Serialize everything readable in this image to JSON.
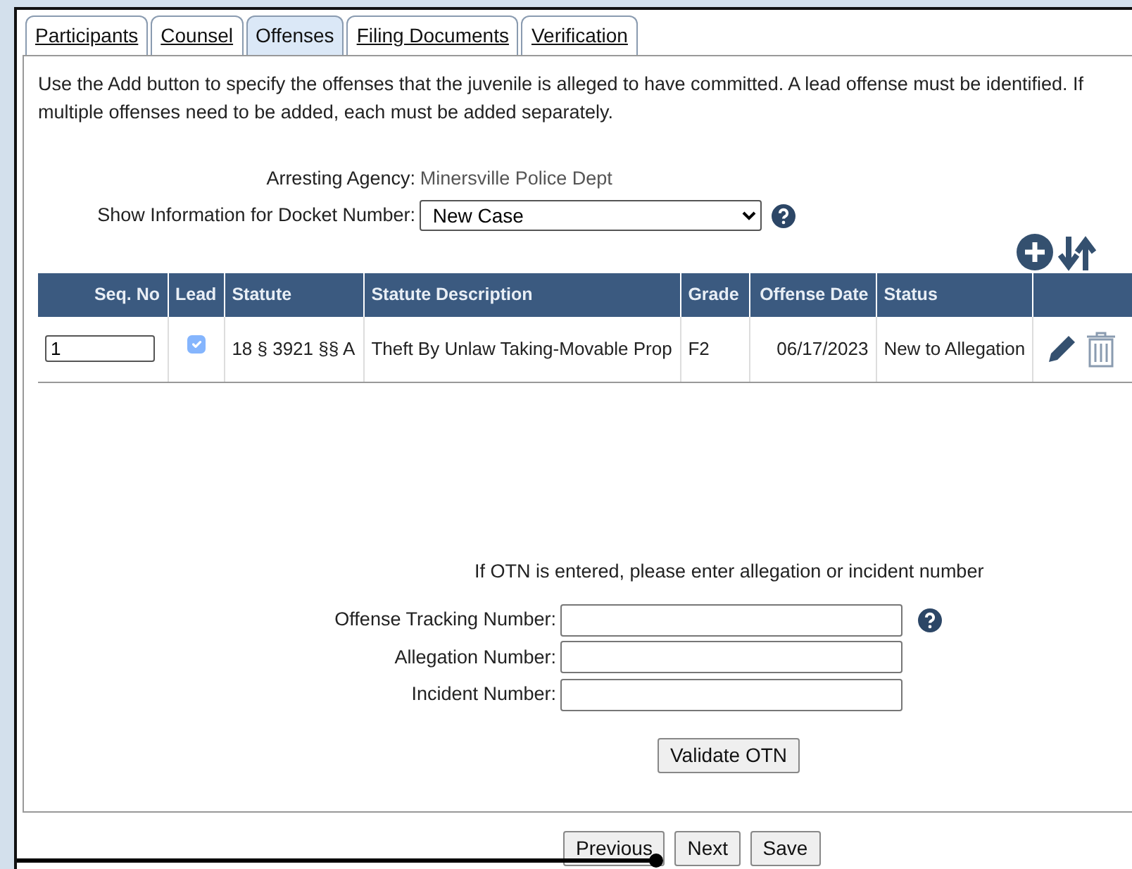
{
  "tabs": [
    {
      "label": "Participants",
      "selected": false
    },
    {
      "label": "Counsel",
      "selected": false
    },
    {
      "label": "Offenses",
      "selected": true
    },
    {
      "label": "Filing Documents",
      "selected": false
    },
    {
      "label": "Verification",
      "selected": false
    }
  ],
  "instructions": "Use the Add button to specify the offenses that the juvenile is alleged to have committed. A lead offense must be identified. If multiple offenses need to be added, each must be added separately.",
  "arresting_agency": {
    "label": "Arresting Agency:",
    "value": "Minersville Police Dept"
  },
  "docket": {
    "label": "Show Information for Docket Number:",
    "value": "New Case"
  },
  "table": {
    "columns": [
      "Seq. No",
      "Lead",
      "Statute",
      "Statute Description",
      "Grade",
      "Offense Date",
      "Status"
    ],
    "rows": [
      {
        "seq_no": "1",
        "lead_checked": true,
        "lead_disabled": true,
        "statute": "18 § 3921 §§ A",
        "description": "Theft By Unlaw Taking-Movable Prop",
        "grade": "F2",
        "offense_date": "06/17/2023",
        "status": "New to Allegation"
      }
    ]
  },
  "otn_note": "If OTN is entered, please enter allegation or incident number",
  "otn_fields": [
    {
      "label": "Offense Tracking Number:",
      "help": true
    },
    {
      "label": "Allegation Number:",
      "help": false
    },
    {
      "label": "Incident Number:",
      "help": false
    }
  ],
  "validate_button": "Validate OTN",
  "nav_buttons": [
    "Previous",
    "Next",
    "Save"
  ]
}
